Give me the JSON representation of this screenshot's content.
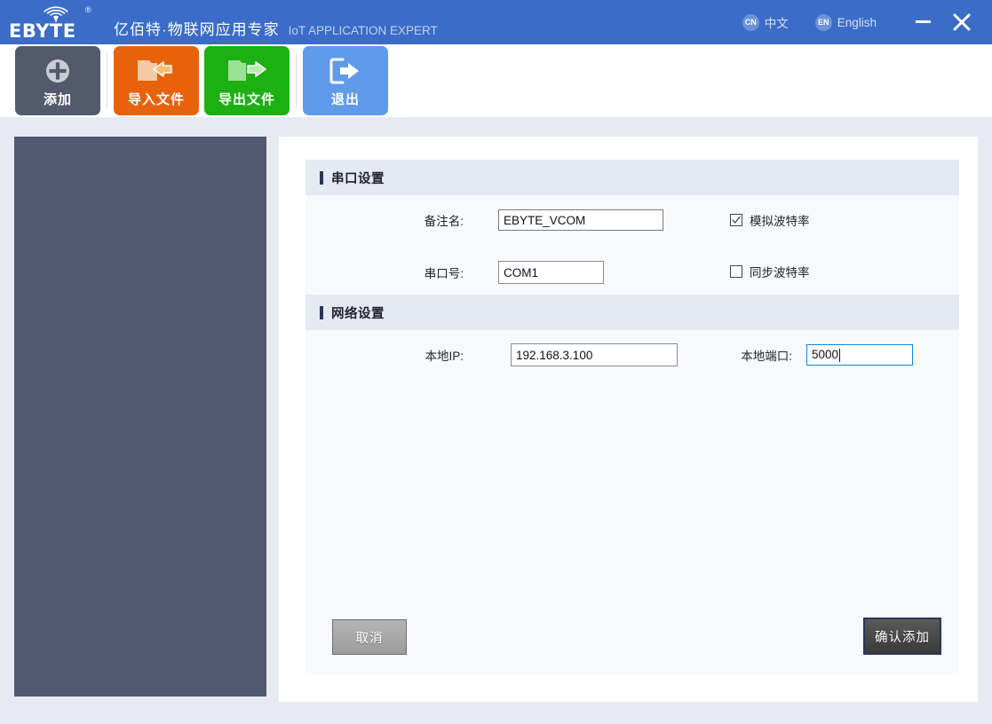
{
  "titlebar": {
    "logo_text": "EBYTE",
    "logo_registered": "®",
    "brand_cn": "亿佰特·物联网应用专家",
    "brand_en": "IoT APPLICATION EXPERT",
    "lang_cn_badge": "CN",
    "lang_cn_label": "中文",
    "lang_en_badge": "EN",
    "lang_en_label": "English",
    "minimize_label": "—",
    "close_label": "✕",
    "bg_color": "#3a6cc8"
  },
  "toolbar": {
    "buttons": [
      {
        "id": "add",
        "label": "添加",
        "icon": "plus-circle-icon",
        "color": "#535a6b"
      },
      {
        "id": "import",
        "label": "导入文件",
        "icon": "folder-import-icon",
        "color": "#e8620c"
      },
      {
        "id": "export",
        "label": "导出文件",
        "icon": "folder-export-icon",
        "color": "#1cb012"
      },
      {
        "id": "exit",
        "label": "退出",
        "icon": "exit-arrow-icon",
        "color": "#5f9bea"
      }
    ]
  },
  "sidebar": {
    "bg_color": "#515870",
    "items": []
  },
  "form": {
    "serial_section": {
      "title": "串口设置",
      "fields": {
        "remark_label": "备注名:",
        "remark_value": "EBYTE_VCOM",
        "remark_placeholder": "",
        "port_label": "串口号:",
        "port_value": "COM1",
        "port_options": [
          "COM1"
        ]
      },
      "checkboxes": [
        {
          "id": "sim-baud",
          "label": "模拟波特率",
          "checked": true
        },
        {
          "id": "sync-baud",
          "label": "同步波特率",
          "checked": false
        }
      ]
    },
    "network_section": {
      "title": "网络设置",
      "fields": {
        "local_ip_label": "本地IP:",
        "local_ip_value": "192.168.3.100",
        "local_ip_options": [
          "192.168.3.100"
        ],
        "local_port_label": "本地端口:",
        "local_port_value": "5000",
        "local_port_placeholder": ""
      }
    }
  },
  "footer": {
    "cancel_label": "取消",
    "confirm_label": "确认添加"
  }
}
